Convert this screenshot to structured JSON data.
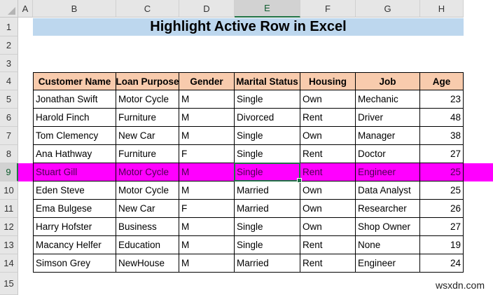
{
  "columns": [
    "A",
    "B",
    "C",
    "D",
    "E",
    "F",
    "G",
    "H"
  ],
  "rows": [
    "1",
    "2",
    "3",
    "4",
    "5",
    "6",
    "7",
    "8",
    "9",
    "10",
    "11",
    "12",
    "13",
    "14",
    "15"
  ],
  "selected_column": "E",
  "selected_row": "9",
  "title": "Highlight Active Row in Excel",
  "table": {
    "headers": [
      "Customer Name",
      "Loan Purpose",
      "Gender",
      "Marital Status",
      "Housing",
      "Job",
      "Age"
    ],
    "rows": [
      [
        "Jonathan Swift",
        "Motor Cycle",
        "M",
        "Single",
        "Own",
        "Mechanic",
        "23"
      ],
      [
        "Harold Finch",
        "Furniture",
        "M",
        "Divorced",
        "Rent",
        "Driver",
        "48"
      ],
      [
        "Tom Clemency",
        "New Car",
        "M",
        "Single",
        "Own",
        "Manager",
        "38"
      ],
      [
        "Ana Hathway",
        "Furniture",
        "F",
        "Single",
        "Rent",
        "Doctor",
        "27"
      ],
      [
        "Stuart Gill",
        "Motor Cycle",
        "M",
        "Single",
        "Rent",
        "Engineer",
        "25"
      ],
      [
        "Eden Steve",
        "Motor Cycle",
        "M",
        "Married",
        "Own",
        "Data Analyst",
        "25"
      ],
      [
        "Ema Bulgese",
        "New Car",
        "F",
        "Married",
        "Own",
        "Researcher",
        "26"
      ],
      [
        "Harry Hofster",
        "Business",
        "M",
        "Single",
        "Own",
        "Shop Owner",
        "27"
      ],
      [
        "Macancy Helfer",
        "Education",
        "M",
        "Single",
        "Rent",
        "None",
        "19"
      ],
      [
        "Simson Grey",
        "NewHouse",
        "M",
        "Married",
        "Rent",
        "Engineer",
        "24"
      ]
    ]
  },
  "highlight_color": "#ff00ff",
  "watermark": "wsxdn.com"
}
